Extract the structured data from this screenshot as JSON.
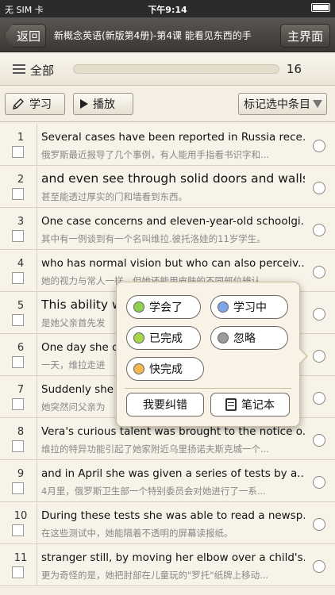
{
  "status": {
    "carrier": "无 SIM 卡",
    "time": "下午9:14"
  },
  "nav": {
    "back_label": "返回",
    "title": "新概念英语(新版第4册)-第4课  能看见东西的手",
    "main_label": "主界面"
  },
  "filter": {
    "label": "全部",
    "count": "16"
  },
  "toolbar": {
    "learn_label": "学习",
    "play_label": "播放",
    "mark_label": "标记选中条目"
  },
  "rows": [
    {
      "num": "1",
      "en": "Several cases have been reported in Russia rece...",
      "zh": "俄罗斯最近报导了几个事例，有人能用手指看书识字和..."
    },
    {
      "num": "2",
      "en": "and even see through solid doors and walls.",
      "zh": "甚至能透过厚实的门和墙看到东西。"
    },
    {
      "num": "3",
      "en": "One case concerns and eleven-year-old schoolgi...",
      "zh": "其中有一例谈到有一个名叫维拉.彼托洛娃的11岁学生。"
    },
    {
      "num": "4",
      "en": "who has normal vision but who can also perceiv...",
      "zh": "她的视力与常人一样，但她还能用皮肤的不同部位辨认..."
    },
    {
      "num": "5",
      "en": "This ability w",
      "zh": "是她父亲首先发"
    },
    {
      "num": "6",
      "en": "One day she c",
      "zh": "一天，维拉走进"
    },
    {
      "num": "7",
      "en": "Suddenly she",
      "zh": "她突然问父亲为"
    },
    {
      "num": "8",
      "en": "Vera's curious talent was brought to the notice o...",
      "zh": "维拉的特异功能引起了她家附近乌里扬诺夫斯克城一个..."
    },
    {
      "num": "9",
      "en": "and in April she was given a series of tests by a...",
      "zh": "4月里，俄罗斯卫生部一个特别委员会对她进行了一系..."
    },
    {
      "num": "10",
      "en": "During these tests she was able to read a newsp...",
      "zh": "在这些测试中，她能隔着不透明的屏幕读报纸。"
    },
    {
      "num": "11",
      "en": "stranger still, by moving her elbow over a child's...",
      "zh": "更为奇怪的是，她把肘部在儿童玩的\"罗托\"纸牌上移动..."
    }
  ],
  "popup": {
    "learned": "学会了",
    "learning": "学习中",
    "completed": "已完成",
    "ignore": "忽略",
    "almost": "快完成",
    "correct": "我要纠错",
    "notebook": "笔记本",
    "colors": {
      "learned": "#8fd14f",
      "learning": "#7fa4e8",
      "completed": "#a8d84a",
      "ignore": "#9a9a9a",
      "almost": "#f0b84e"
    }
  }
}
